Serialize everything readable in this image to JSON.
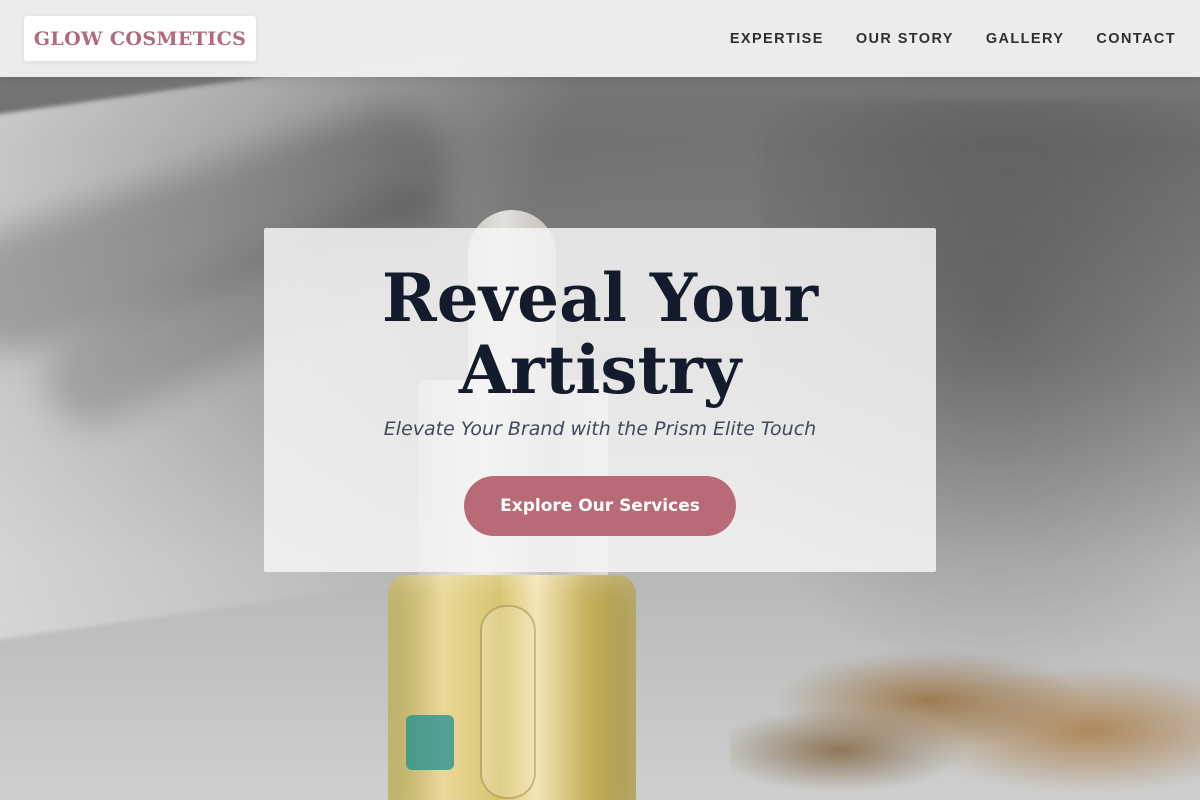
{
  "brand": {
    "name": "GLOW COSMETICS",
    "color": "#b06a7b"
  },
  "nav": {
    "items": [
      {
        "label": "EXPERTISE"
      },
      {
        "label": "OUR STORY"
      },
      {
        "label": "GALLERY"
      },
      {
        "label": "CONTACT"
      }
    ]
  },
  "hero": {
    "title": "Reveal Your Artistry",
    "subtitle": "Elevate Your Brand with the Prism Elite Touch",
    "cta_label": "Explore Our Services",
    "cta_color": "#b96a77",
    "title_color": "#141b2d"
  }
}
